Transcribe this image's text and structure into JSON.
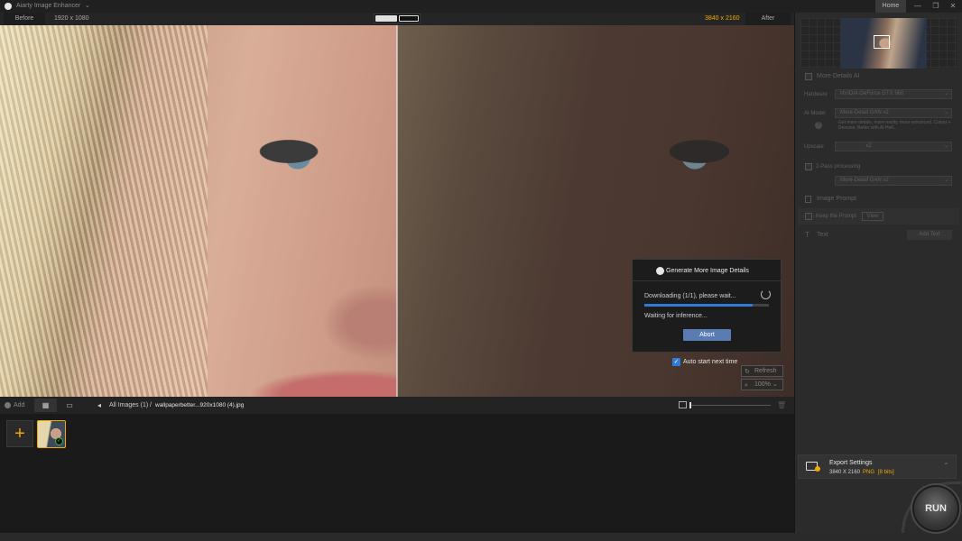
{
  "app": {
    "title": "Aiarty Image Enhancer",
    "home_tab": "Home"
  },
  "window": {
    "min": "—",
    "restore": "❐",
    "close": "✕"
  },
  "compare": {
    "before_label": "Before",
    "before_res": "1920 x 1080",
    "after_res": "3840 x 2160",
    "after_label": "After"
  },
  "dialog": {
    "title": "Generate More Image Details",
    "download_status": "Downloading (1/1), please wait...",
    "progress": 0.87,
    "wait_status": "Waiting for inference...",
    "abort_label": "Abort",
    "auto_start_label": "Auto start next time",
    "auto_start_checked": true
  },
  "overlay": {
    "refresh_label": "Refresh",
    "zoom_label": "100%"
  },
  "filebar": {
    "add_label": "Add",
    "crumb_all": "All Images (1)",
    "crumb_sep": "/",
    "crumb_file": "wallpaperbetter...920x1080 (4).jpg"
  },
  "thumbs": {
    "add_glyph": "+",
    "check_glyph": "✓"
  },
  "right_panel": {
    "section1_title": "More Details AI",
    "hardware_label": "Hardware",
    "hardware_value": "NVIDIA GeForce GTX 960",
    "ai_model_label": "AI Model",
    "ai_model_value": "More-Detail GAN v2",
    "ai_model_desc": "Get more details, more reality, more enhanced. Colour + Denoise, Better with AI Hell...",
    "upscale_label": "Upscale",
    "upscale_value": "x2",
    "two_pass_label": "2-Pass processing",
    "two_pass_value": "More-Detail GAN v2",
    "image_prompt_title": "Image Prompt",
    "keep_prompt_label": "Keep the Prompt",
    "view_label": "View",
    "text_title": "Text",
    "add_text_label": "Add Text"
  },
  "export": {
    "title": "Export Settings",
    "resolution": "3840 X 2160",
    "format": "PNG",
    "bits": "[8 bits]"
  },
  "run_label": "RUN",
  "colors": {
    "accent": "#f2a900",
    "progress": "#2f7bd6",
    "abort": "#5a7cb2"
  },
  "icons": {
    "dialog": "aperture-icon",
    "refresh": "refresh-icon",
    "zoom": "zoom-icon",
    "add": "plus-circle-icon",
    "export": "monitor-gear-icon"
  }
}
